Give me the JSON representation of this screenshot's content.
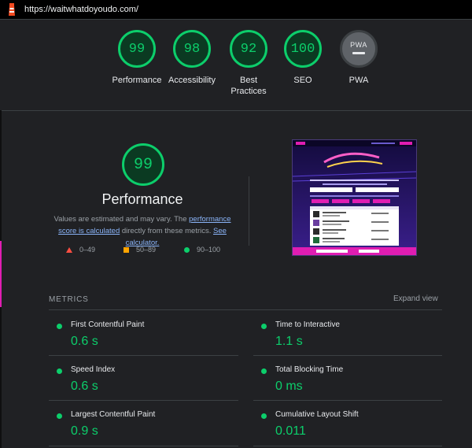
{
  "address_bar": {
    "url": "https://waitwhatdoyoudo.com/"
  },
  "categories": [
    {
      "score": "99",
      "label": "Performance"
    },
    {
      "score": "98",
      "label": "Accessibility"
    },
    {
      "score": "92",
      "label": "Best Practices"
    },
    {
      "score": "100",
      "label": "SEO"
    },
    {
      "score": "PWA",
      "label": "PWA"
    }
  ],
  "performance": {
    "score": "99",
    "title": "Performance",
    "desc_prefix": "Values are estimated and may vary. The ",
    "link1": "performance score is calculated",
    "desc_middle": " directly from these metrics. ",
    "link2": "See calculator."
  },
  "legend": [
    {
      "range": "0–49",
      "color": "#ff4e42"
    },
    {
      "range": "50–89",
      "color": "#ffa400"
    },
    {
      "range": "90–100",
      "color": "#0cce6b"
    }
  ],
  "metrics": {
    "heading": "METRICS",
    "expand_label": "Expand view",
    "items": [
      {
        "name": "First Contentful Paint",
        "value": "0.6 s"
      },
      {
        "name": "Time to Interactive",
        "value": "1.1 s"
      },
      {
        "name": "Speed Index",
        "value": "0.6 s"
      },
      {
        "name": "Total Blocking Time",
        "value": "0 ms"
      },
      {
        "name": "Largest Contentful Paint",
        "value": "0.9 s"
      },
      {
        "name": "Cumulative Layout Shift",
        "value": "0.011"
      }
    ]
  },
  "colors": {
    "pass": "#0cce6b",
    "average": "#ffa400",
    "fail": "#ff4e42",
    "background": "#202124",
    "link": "#8ab4f8"
  }
}
